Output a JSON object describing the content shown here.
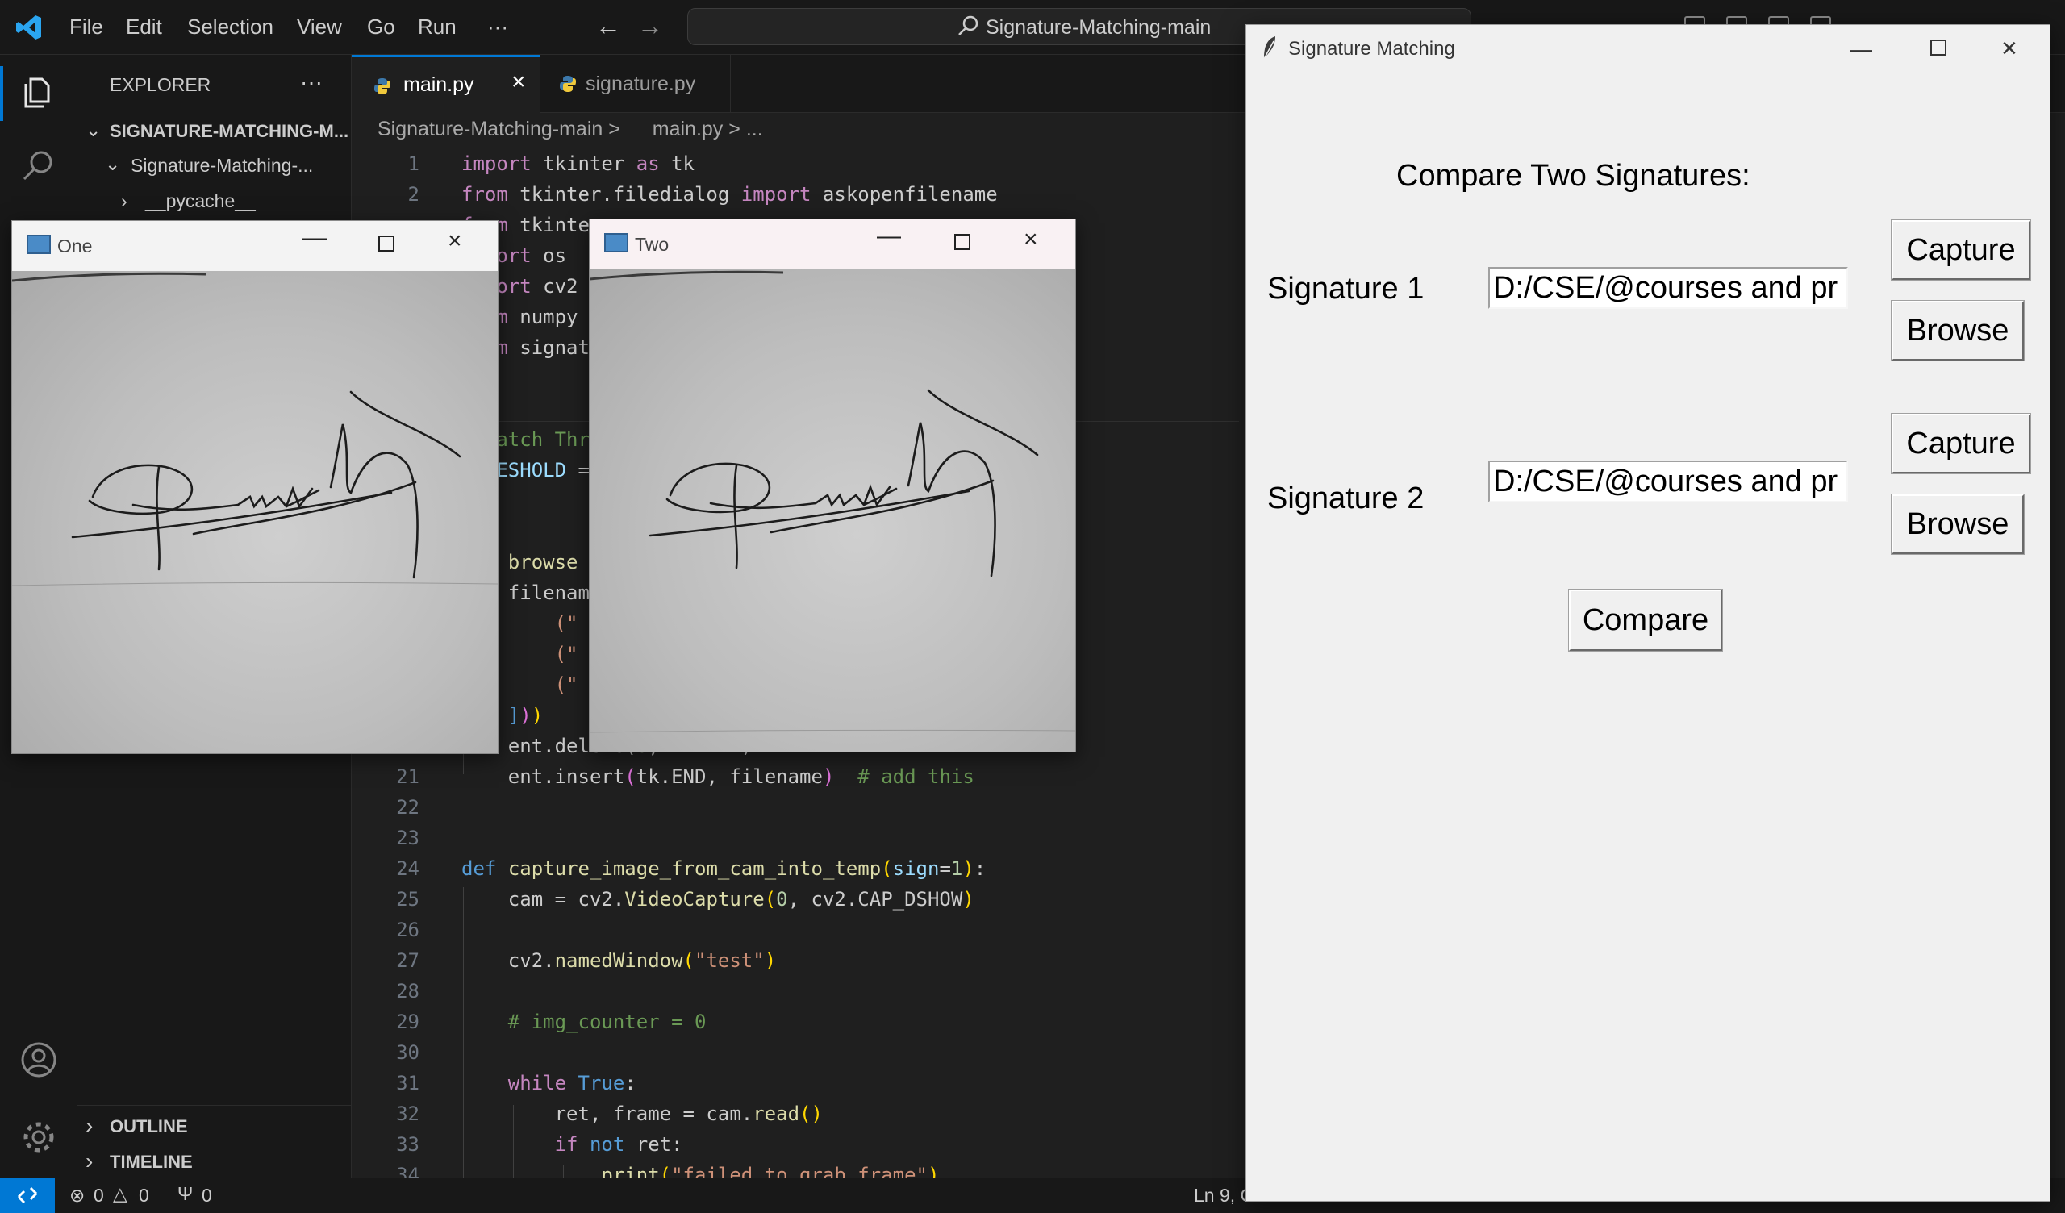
{
  "vscode": {
    "menu": [
      "File",
      "Edit",
      "Selection",
      "View",
      "Go",
      "Run",
      "···"
    ],
    "command_center": "Signature-Matching-main",
    "explorer": {
      "title": "EXPLORER",
      "more": "···",
      "root": "SIGNATURE-MATCHING-M...",
      "folder": "Signature-Matching-...",
      "subfolder": "__pycache__",
      "outline": "OUTLINE",
      "timeline": "TIMELINE"
    },
    "tabs": [
      {
        "label": "main.py",
        "active": true
      },
      {
        "label": "signature.py",
        "active": false
      }
    ],
    "breadcrumb": {
      "folder": "Signature-Matching-main",
      "sep": ">",
      "file": "main.py",
      "more": "..."
    },
    "status": {
      "errors": "0",
      "warnings": "0",
      "ports": "0",
      "position": "Ln 9, Col 1"
    }
  },
  "windows": {
    "one": {
      "title": "One"
    },
    "two": {
      "title": "Two"
    }
  },
  "tk": {
    "title": "Signature Matching",
    "heading": "Compare Two Signatures:",
    "sig1_label": "Signature 1",
    "sig1_path": "D:/CSE/@courses and pr",
    "sig2_label": "Signature 2",
    "sig2_path": "D:/CSE/@courses and pr",
    "capture": "Capture",
    "browse": "Browse",
    "compare": "Compare"
  },
  "colors": {
    "accent": "#0078d4",
    "editor_bg": "#1f1f1f",
    "tk_bg": "#f0f0f0"
  }
}
